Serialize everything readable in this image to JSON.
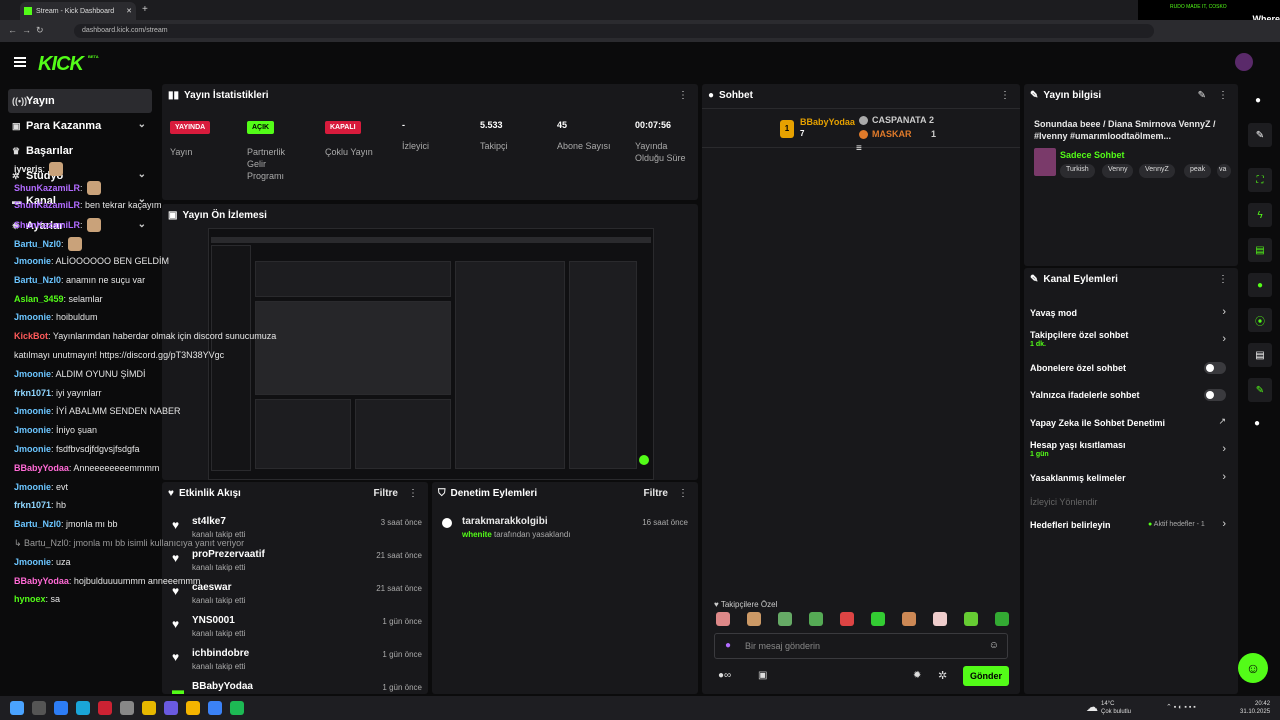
{
  "browser": {
    "tab_title": "Stream - Kick Dashboard",
    "url": "dashboard.kick.com/stream",
    "promo_small": "RUDO MADE IT, COSKO",
    "promo_big": "Where"
  },
  "logo": "KICK",
  "logo_beta": "BETA",
  "sidebar": [
    {
      "label": "Yayın",
      "icon": "broadcast-icon",
      "active": true
    },
    {
      "label": "Para Kazanma",
      "icon": "wallet-icon",
      "chevron": true
    },
    {
      "label": "Başarılar",
      "icon": "trophy-icon"
    },
    {
      "label": "Stüdyo",
      "icon": "gear-icon",
      "chevron": true
    },
    {
      "label": "Kanal",
      "icon": "tv-icon",
      "chevron": true
    },
    {
      "label": "Ayarlar",
      "icon": "settings-icon",
      "chevron": true
    }
  ],
  "stats": {
    "title": "Yayın İstatistikleri",
    "badges": [
      {
        "text": "YAYINDA",
        "label": "Yayın",
        "color": "#d81b3c"
      },
      {
        "text": "AÇIK",
        "label": "Partnerlik Gelir Programı",
        "color": "#53fc18"
      },
      {
        "text": "KAPALI",
        "label": "Çoklu Yayın",
        "color": "#d81b3c"
      }
    ],
    "values": [
      {
        "value": "-",
        "label": "İzleyici"
      },
      {
        "value": "5.533",
        "label": "Takipçi"
      },
      {
        "value": "45",
        "label": "Abone Sayısı"
      },
      {
        "value": "00:07:56",
        "label": "Yayında Olduğu Süre"
      }
    ]
  },
  "preview": {
    "title": "Yayın Ön İzlemesi"
  },
  "activity": {
    "title": "Etkinlik Akışı",
    "filter": "Filtre",
    "items": [
      {
        "name": "st4lke7",
        "sub": "kanalı takip etti",
        "time": "3 saat önce"
      },
      {
        "name": "proPrezervaatif",
        "sub": "kanalı takip etti",
        "time": "21 saat önce"
      },
      {
        "name": "caeswar",
        "sub": "kanalı takip etti",
        "time": "21 saat önce"
      },
      {
        "name": "YNS0001",
        "sub": "kanalı takip etti",
        "time": "1 gün önce"
      },
      {
        "name": "ichbindobre",
        "sub": "kanalı takip etti",
        "time": "1 gün önce"
      },
      {
        "name": "BBabyYodaa",
        "sub": "",
        "time": "1 gün önce"
      }
    ]
  },
  "moderation": {
    "title": "Denetim Eylemleri",
    "filter": "Filtre",
    "item": {
      "name": "tarakmarakkolgibi",
      "by": "whenite",
      "suffix": "tarafından yasaklandı",
      "time": "16 saat önce"
    }
  },
  "chat": {
    "title": "Sohbet",
    "leaders": {
      "first": {
        "name": "BBabyYodaa",
        "count": "7"
      },
      "second": {
        "name": "CASPANATA",
        "count": "2"
      },
      "third": {
        "name": "MASKAR",
        "count": "1"
      }
    },
    "messages": [
      {
        "user": "iyveris",
        "color": "#e6e6e6",
        "text": ":",
        "emote": true
      },
      {
        "user": "ShunKazamiLR",
        "color": "#b26bff",
        "text": ":",
        "emote": true
      },
      {
        "user": "ShunKazamiLR",
        "color": "#b26bff",
        "text": ": ben tekrar kaçayım"
      },
      {
        "user": "ShunKazamiLR",
        "color": "#b26bff",
        "text": ":",
        "emote": true
      },
      {
        "user": "Bartu_Nzl0",
        "color": "#6bc5ff",
        "text": ":",
        "emote": true
      },
      {
        "user": "Jmoonie",
        "color": "#6bc5ff",
        "text": ": ALİOOOOOO BEN GELDİM"
      },
      {
        "user": "Bartu_Nzl0",
        "color": "#6bc5ff",
        "text": ": anamın ne suçu var"
      },
      {
        "user": "Aslan_3459",
        "color": "#53fc18",
        "text": ": selamlar"
      },
      {
        "user": "Jmoonie",
        "color": "#6bc5ff",
        "text": ": hoibuldum"
      },
      {
        "user": "KickBot",
        "color": "#ff5a5a",
        "text": ": Yayınlarımdan haberdar olmak için discord sunucumuza"
      },
      {
        "user": "",
        "color": "#e6e6e6",
        "text": "katılmayı unutmayın! https://discord.gg/pT3N38YVgc"
      },
      {
        "user": "Jmoonie",
        "color": "#6bc5ff",
        "text": ": ALDIM OYUNU ŞİMDİ"
      },
      {
        "user": "frkn1071",
        "color": "#8fd6ff",
        "text": ": iyi yayınlarr"
      },
      {
        "user": "Jmoonie",
        "color": "#6bc5ff",
        "text": ": İYİ ABALMM SENDEN NABER"
      },
      {
        "user": "Jmoonie",
        "color": "#6bc5ff",
        "text": ": İniyo şuan"
      },
      {
        "user": "Jmoonie",
        "color": "#6bc5ff",
        "text": ": fsdfbvsdjfdgvsjfsdgfa"
      },
      {
        "user": "BBabyYodaa",
        "color": "#ff6ad5",
        "text": ": Anneeeeeeeemmmm"
      },
      {
        "user": "Jmoonie",
        "color": "#6bc5ff",
        "text": ": evt"
      },
      {
        "user": "frkn1071",
        "color": "#8fd6ff",
        "text": ": hb"
      },
      {
        "user": "Bartu_Nzl0",
        "color": "#6bc5ff",
        "text": ": jmonla mı bb"
      },
      {
        "user": "",
        "color": "#9a9a9a",
        "text": "↳ Bartu_Nzl0: jmonla mı bb isimli kullanıcıya yanıt veriyor"
      },
      {
        "user": "Jmoonie",
        "color": "#6bc5ff",
        "text": ": uza"
      },
      {
        "user": "BBabyYodaa",
        "color": "#ff6ad5",
        "text": ": hojbulduuuummm anneeemmm"
      },
      {
        "user": "hynoex",
        "color": "#53fc18",
        "text": ": sa"
      }
    ],
    "follower_label": "Takipçilere Özel",
    "input_placeholder": "Bir mesaj gönderin",
    "send": "Gönder"
  },
  "stream_info": {
    "title": "Yayın bilgisi",
    "stream_title": "Sonundaa beee / Diana Smirnova VennyZ / #Ivenny #umarımloodtaölmem...",
    "mode": "Sadece Sohbet",
    "tags": [
      "Turkish",
      "Venny",
      "VennyZ",
      "peak",
      "va"
    ]
  },
  "channel_actions": {
    "title": "Kanal Eylemleri",
    "items": [
      {
        "label": "Yavaş mod",
        "type": "arrow"
      },
      {
        "label": "Takipçilere özel sohbet",
        "sub": "1 dk.",
        "type": "arrow"
      },
      {
        "label": "Abonelere özel sohbet",
        "type": "toggle"
      },
      {
        "label": "Yalnızca ifadelerle sohbet",
        "type": "toggle"
      },
      {
        "label": "Yapay Zeka ile Sohbet Denetimi",
        "type": "external"
      },
      {
        "label": "Hesap yaşı kısıtlaması",
        "sub": "1 gün",
        "type": "arrow"
      },
      {
        "label": "Yasaklanmış kelimeler",
        "type": "arrow"
      },
      {
        "label": "İzleyici Yönlendir",
        "type": "disabled"
      },
      {
        "label": "Hedefleri belirleyin",
        "status": "Aktif hedefler - 1",
        "type": "arrow"
      }
    ]
  },
  "taskbar": {
    "weather_temp": "14°C",
    "weather_text": "Çok bulutlu",
    "time": "20:42",
    "date": "31.10.2025"
  }
}
